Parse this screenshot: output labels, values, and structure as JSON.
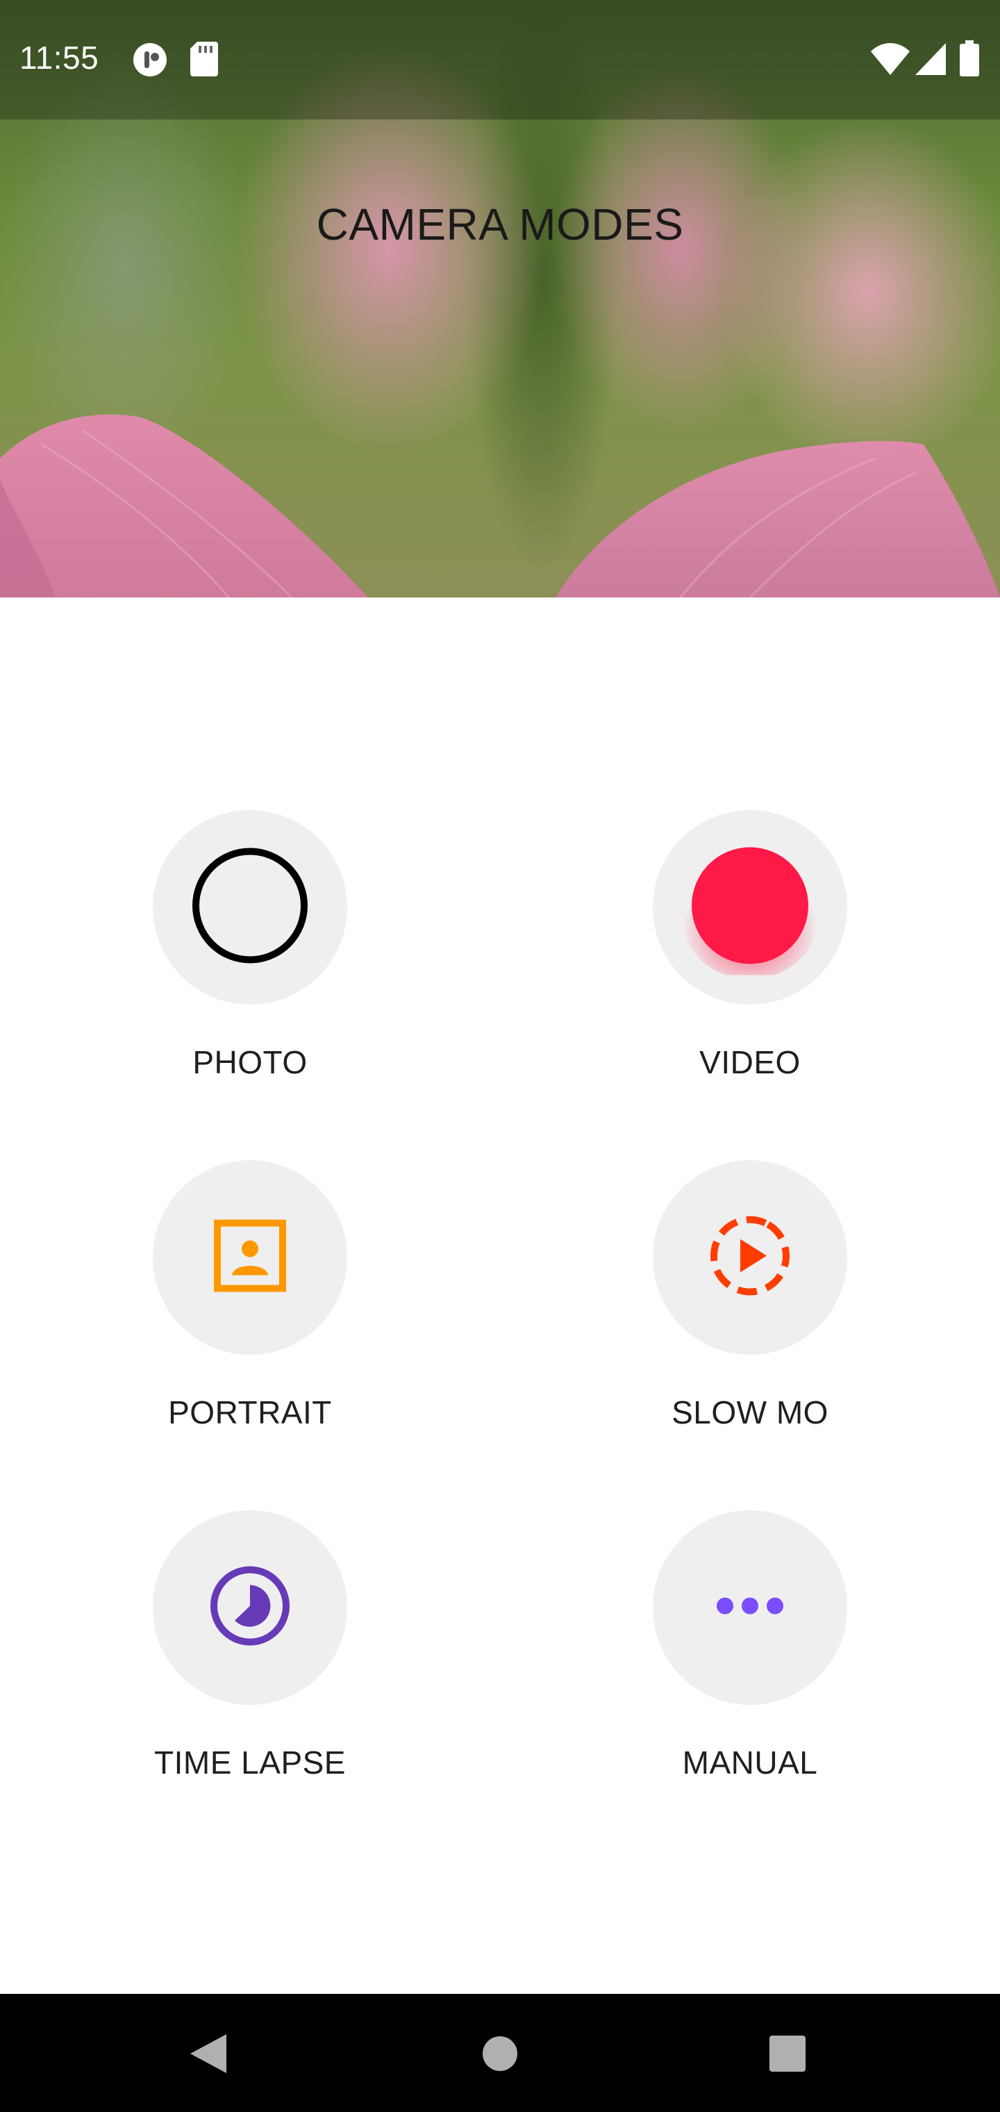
{
  "status_bar": {
    "time": "11:55",
    "icons": [
      "notification-icon",
      "sd-card-icon",
      "wifi-icon",
      "cell-signal-icon",
      "battery-icon"
    ]
  },
  "header": {
    "title": "CAMERA MODES"
  },
  "modes": [
    {
      "label": "PHOTO",
      "icon": "photo-shutter-icon",
      "color": "#000000"
    },
    {
      "label": "VIDEO",
      "icon": "record-icon",
      "color": "#ff1744"
    },
    {
      "label": "PORTRAIT",
      "icon": "portrait-icon",
      "color": "#ff9800"
    },
    {
      "label": "SLOW MO",
      "icon": "slow-motion-icon",
      "color": "#ff3d00"
    },
    {
      "label": "TIME LAPSE",
      "icon": "timelapse-icon",
      "color": "#673ab7"
    },
    {
      "label": "MANUAL",
      "icon": "more-horiz-icon",
      "color": "#7c4dff"
    }
  ],
  "navigation": {
    "buttons": [
      "back-icon",
      "home-icon",
      "recents-icon"
    ]
  }
}
